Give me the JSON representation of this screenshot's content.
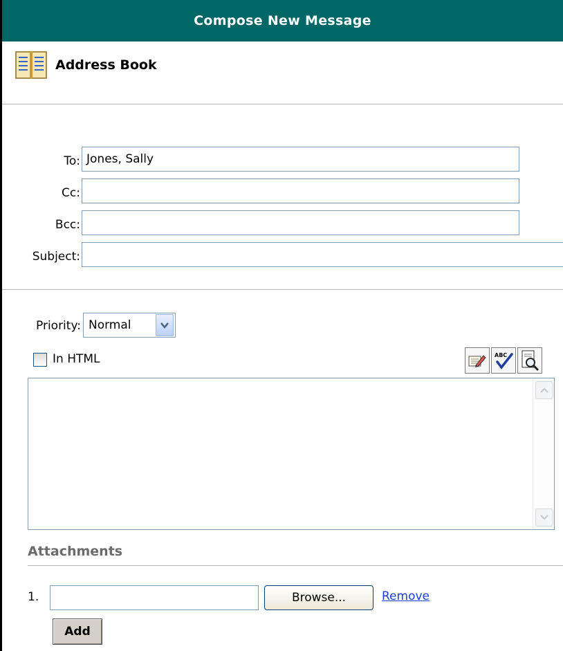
{
  "header": {
    "title": "Compose New Message"
  },
  "address_book": {
    "label": "Address Book",
    "icon": "address-book-icon"
  },
  "fields": {
    "to_label": "To:",
    "to_value": "Jones, Sally",
    "cc_label": "Cc:",
    "cc_value": "",
    "bcc_label": "Bcc:",
    "bcc_value": "",
    "subject_label": "Subject:",
    "subject_value": ""
  },
  "priority": {
    "label": "Priority:",
    "selected": "Normal"
  },
  "html_option": {
    "label": "In HTML",
    "checked": false
  },
  "toolbar": {
    "icons": [
      "edit-html-icon",
      "spellcheck-icon",
      "preview-icon"
    ],
    "spellcheck_text": "ABC"
  },
  "body": {
    "value": ""
  },
  "attachments": {
    "title": "Attachments",
    "items": [
      {
        "number": "1.",
        "value": "",
        "browse_label": "Browse...",
        "remove_label": "Remove"
      }
    ],
    "add_label": "Add"
  },
  "colors": {
    "header_bg": "#006666",
    "link": "#1a3fd6",
    "section_title": "#6b6b6b"
  }
}
